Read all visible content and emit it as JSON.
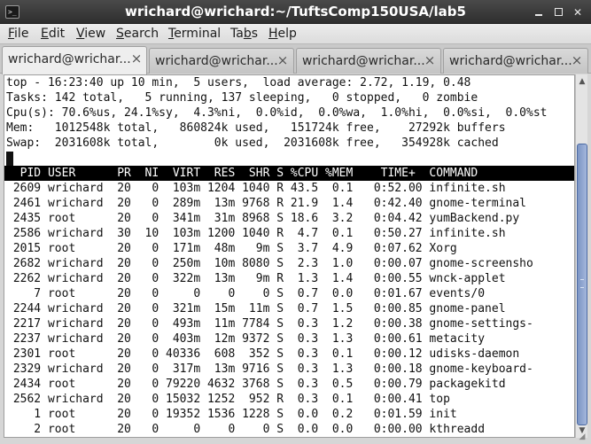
{
  "window": {
    "title": "wrichard@wrichard:~/TuftsComp150USA/lab5",
    "icon": "terminal-icon",
    "buttons": [
      "minimize-icon",
      "maximize-icon",
      "close-icon"
    ]
  },
  "menubar": {
    "items": [
      {
        "label": "File",
        "mnemonic": "F",
        "rest": "ile"
      },
      {
        "label": "Edit",
        "mnemonic": "E",
        "rest": "dit"
      },
      {
        "label": "View",
        "mnemonic": "V",
        "rest": "iew"
      },
      {
        "label": "Search",
        "mnemonic": "S",
        "rest": "earch"
      },
      {
        "label": "Terminal",
        "mnemonic": "T",
        "rest": "erminal"
      },
      {
        "label": "Tabs",
        "pre": "Ta",
        "mnemonic": "b",
        "rest": "s"
      },
      {
        "label": "Help",
        "mnemonic": "H",
        "rest": "elp"
      }
    ]
  },
  "tabs": [
    {
      "label": "wrichard@wrichar...",
      "active": true
    },
    {
      "label": "wrichard@wrichar...",
      "active": false
    },
    {
      "label": "wrichard@wrichar...",
      "active": false
    },
    {
      "label": "wrichard@wrichar...",
      "active": false
    }
  ],
  "top": {
    "summary": [
      "top - 16:23:40 up 10 min,  5 users,  load average: 2.72, 1.19, 0.48",
      "Tasks: 142 total,   5 running, 137 sleeping,   0 stopped,   0 zombie",
      "Cpu(s): 70.6%us, 24.1%sy,  4.3%ni,  0.0%id,  0.0%wa,  1.0%hi,  0.0%si,  0.0%st",
      "Mem:   1012548k total,   860824k used,   151724k free,    27292k buffers",
      "Swap:  2031608k total,        0k used,  2031608k free,   354928k cached"
    ],
    "columns": "  PID USER      PR  NI  VIRT  RES  SHR S %CPU %MEM    TIME+  COMMAND",
    "processes": [
      " 2609 wrichard  20   0  103m 1204 1040 R 43.5  0.1   0:52.00 infinite.sh",
      " 2461 wrichard  20   0  289m  13m 9768 R 21.9  1.4   0:42.40 gnome-terminal",
      " 2435 root      20   0  341m  31m 8968 S 18.6  3.2   0:04.42 yumBackend.py",
      " 2586 wrichard  30  10  103m 1200 1040 R  4.7  0.1   0:50.27 infinite.sh",
      " 2015 root      20   0  171m  48m   9m S  3.7  4.9   0:07.62 Xorg",
      " 2682 wrichard  20   0  250m  10m 8080 S  2.3  1.0   0:00.07 gnome-screensho",
      " 2262 wrichard  20   0  322m  13m   9m R  1.3  1.4   0:00.55 wnck-applet",
      "    7 root      20   0     0    0    0 S  0.7  0.0   0:01.67 events/0",
      " 2244 wrichard  20   0  321m  15m  11m S  0.7  1.5   0:00.85 gnome-panel",
      " 2217 wrichard  20   0  493m  11m 7784 S  0.3  1.2   0:00.38 gnome-settings-",
      " 2237 wrichard  20   0  403m  12m 9372 S  0.3  1.3   0:00.61 metacity",
      " 2301 root      20   0 40336  608  352 S  0.3  0.1   0:00.12 udisks-daemon",
      " 2329 wrichard  20   0  317m  13m 9716 S  0.3  1.3   0:00.18 gnome-keyboard-",
      " 2434 root      20   0 79220 4632 3768 S  0.3  0.5   0:00.79 packagekitd",
      " 2562 wrichard  20   0 15032 1252  952 R  0.3  0.1   0:00.41 top",
      "    1 root      20   0 19352 1536 1228 S  0.0  0.2   0:01.59 init",
      "    2 root      20   0     0    0    0 S  0.0  0.0   0:00.00 kthreadd"
    ]
  },
  "icons": {
    "tab_close": "×",
    "scroll_up": "▲",
    "scroll_down": "▼",
    "resize": "◢"
  }
}
